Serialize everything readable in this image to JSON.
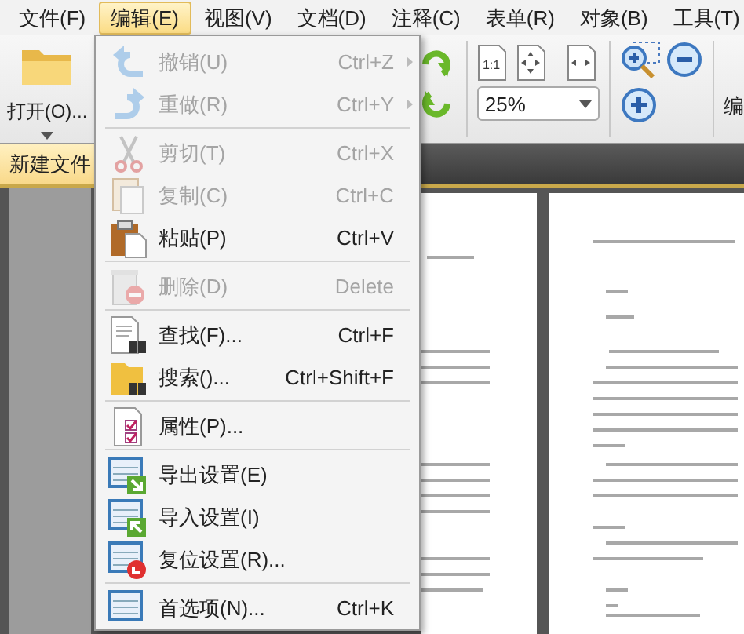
{
  "menubar": [
    {
      "label": "文件(F)",
      "selected": false
    },
    {
      "label": "编辑(E)",
      "selected": true
    },
    {
      "label": "视图(V)",
      "selected": false
    },
    {
      "label": "文档(D)",
      "selected": false
    },
    {
      "label": "注释(C)",
      "selected": false
    },
    {
      "label": "表单(R)",
      "selected": false
    },
    {
      "label": "对象(B)",
      "selected": false
    },
    {
      "label": "工具(T)",
      "selected": false
    }
  ],
  "toolbar": {
    "open_button": {
      "label": "打开(O)..."
    },
    "actual_size_label": "1:1",
    "zoom_field": {
      "value": "25%"
    },
    "cut_off_label": "编"
  },
  "tabs": [
    {
      "label": "新建文件",
      "selected": true
    }
  ],
  "edit_menu": {
    "items": [
      {
        "kind": "item",
        "label": "撤销(U)",
        "shortcut": "Ctrl+Z",
        "disabled": true,
        "submenu": true
      },
      {
        "kind": "item",
        "label": "重做(R)",
        "shortcut": "Ctrl+Y",
        "disabled": true,
        "submenu": true
      },
      {
        "kind": "separator"
      },
      {
        "kind": "item",
        "label": "剪切(T)",
        "shortcut": "Ctrl+X",
        "disabled": true,
        "submenu": false
      },
      {
        "kind": "item",
        "label": "复制(C)",
        "shortcut": "Ctrl+C",
        "disabled": true,
        "submenu": false
      },
      {
        "kind": "item",
        "label": "粘贴(P)",
        "shortcut": "Ctrl+V",
        "disabled": false,
        "submenu": false
      },
      {
        "kind": "separator"
      },
      {
        "kind": "item",
        "label": "删除(D)",
        "shortcut": "Delete",
        "disabled": true,
        "submenu": false
      },
      {
        "kind": "separator"
      },
      {
        "kind": "item",
        "label": "查找(F)...",
        "shortcut": "Ctrl+F",
        "disabled": false,
        "submenu": false
      },
      {
        "kind": "item",
        "label": "搜索()...",
        "shortcut": "Ctrl+Shift+F",
        "disabled": false,
        "submenu": false
      },
      {
        "kind": "separator"
      },
      {
        "kind": "item",
        "label": "属性(P)...",
        "disabled": false,
        "submenu": false
      },
      {
        "kind": "separator"
      },
      {
        "kind": "item",
        "label": "导出设置(E)",
        "disabled": false,
        "submenu": false
      },
      {
        "kind": "item",
        "label": "导入设置(I)",
        "disabled": false,
        "submenu": false
      },
      {
        "kind": "item",
        "label": "复位设置(R)...",
        "disabled": false,
        "submenu": false
      },
      {
        "kind": "separator"
      },
      {
        "kind": "item",
        "label": "首选项(N)...",
        "shortcut": "Ctrl+K",
        "disabled": false,
        "submenu": false
      }
    ]
  }
}
